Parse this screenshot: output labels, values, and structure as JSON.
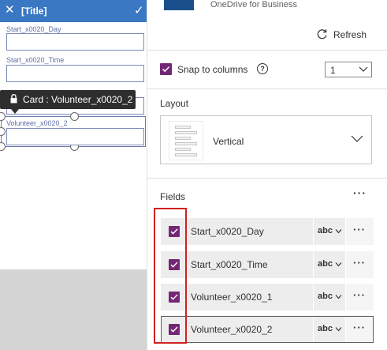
{
  "form": {
    "title": "[Title]",
    "fields": [
      {
        "label": "Start_x0020_Day"
      },
      {
        "label": "Start_x0020_Time"
      },
      {
        "label": "Volunteer_x0020_2"
      }
    ],
    "tooltip": "Card : Volunteer_x0020_2"
  },
  "datasource": {
    "name": "OneDrive for Business",
    "refresh_label": "Refresh",
    "icon": "onedrive-icon"
  },
  "snap": {
    "label": "Snap to columns",
    "checked": true,
    "help": "?",
    "columns_value": "1"
  },
  "layout": {
    "label": "Layout",
    "value": "Vertical"
  },
  "fields_panel": {
    "label": "Fields",
    "more": "···",
    "rows": [
      {
        "name": "Start_x0020_Day",
        "type": "abc",
        "more": "···"
      },
      {
        "name": "Start_x0020_Time",
        "type": "abc",
        "more": "···"
      },
      {
        "name": "Volunteer_x0020_1",
        "type": "abc",
        "more": "···"
      },
      {
        "name": "Volunteer_x0020_2",
        "type": "abc",
        "more": "···"
      }
    ]
  },
  "colors": {
    "accent": "#742774",
    "header": "#3a78c4",
    "highlight": "#d32020"
  }
}
